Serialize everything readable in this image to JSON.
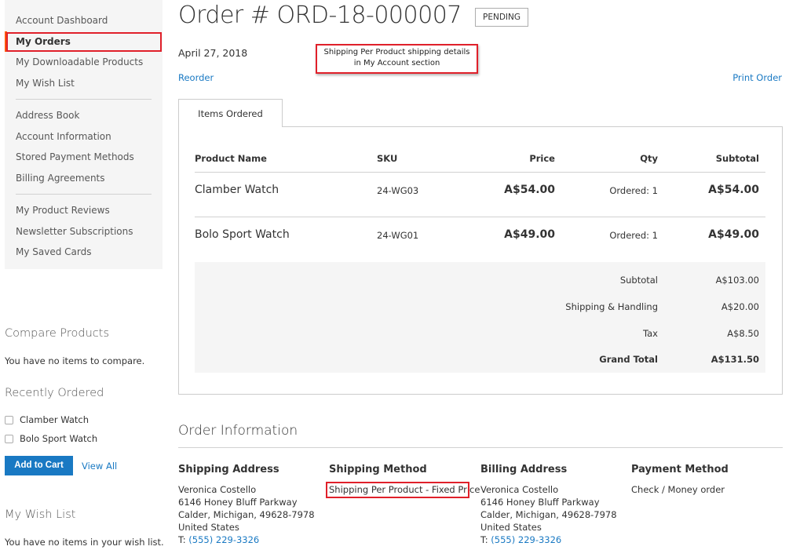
{
  "sidebar": {
    "nav": [
      "Account Dashboard",
      "My Orders",
      "My Downloadable Products",
      "My Wish List"
    ],
    "nav2": [
      "Address Book",
      "Account Information",
      "Stored Payment Methods",
      "Billing Agreements"
    ],
    "nav3": [
      "My Product Reviews",
      "Newsletter Subscriptions",
      "My Saved Cards"
    ],
    "compare_title": "Compare Products",
    "compare_text": "You have no items to compare.",
    "recent_title": "Recently Ordered",
    "recent_items": [
      "Clamber Watch",
      "Bolo Sport Watch"
    ],
    "add_to_cart": "Add to Cart",
    "view_all": "View All",
    "wishlist_title": "My Wish List",
    "wishlist_text": "You have no items in your wish list."
  },
  "order": {
    "title": "Order # ORD-18-000007",
    "status": "PENDING",
    "date": "April 27, 2018",
    "reorder": "Reorder",
    "print": "Print Order",
    "callout_line1": "Shipping Per Product shipping details",
    "callout_line2": "in My Account section",
    "tab": "Items Ordered",
    "headers": {
      "name": "Product Name",
      "sku": "SKU",
      "price": "Price",
      "qty": "Qty",
      "subtotal": "Subtotal"
    },
    "items": [
      {
        "name": "Clamber Watch",
        "sku": "24-WG03",
        "price": "A$54.00",
        "qty": "Ordered: 1",
        "subtotal": "A$54.00"
      },
      {
        "name": "Bolo Sport Watch",
        "sku": "24-WG01",
        "price": "A$49.00",
        "qty": "Ordered: 1",
        "subtotal": "A$49.00"
      }
    ],
    "totals": {
      "subtotal_label": "Subtotal",
      "subtotal": "A$103.00",
      "shipping_label": "Shipping & Handling",
      "shipping": "A$20.00",
      "tax_label": "Tax",
      "tax": "A$8.50",
      "grand_label": "Grand Total",
      "grand": "A$131.50"
    }
  },
  "info": {
    "title": "Order Information",
    "shipping_address": {
      "title": "Shipping Address",
      "name": "Veronica Costello",
      "street": "6146 Honey Bluff Parkway",
      "city": "Calder, Michigan, 49628-7978",
      "country": "United States",
      "phone_prefix": "T: ",
      "phone": "(555) 229-3326"
    },
    "shipping_method": {
      "title": "Shipping Method",
      "value": "Shipping Per Product - Fixed Price"
    },
    "billing_address": {
      "title": "Billing Address",
      "name": "Veronica Costello",
      "street": "6146 Honey Bluff Parkway",
      "city": "Calder, Michigan, 49628-7978",
      "country": "United States",
      "phone_prefix": "T: ",
      "phone": "(555) 229-3326"
    },
    "payment_method": {
      "title": "Payment Method",
      "value": "Check / Money order"
    }
  }
}
